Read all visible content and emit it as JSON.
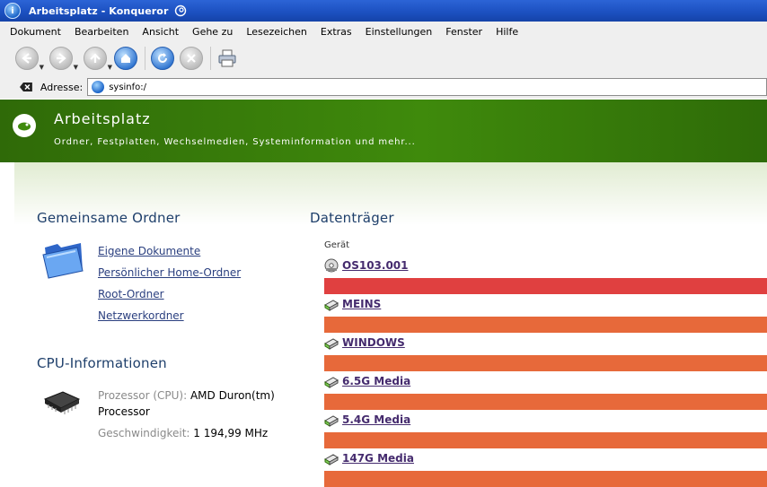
{
  "window": {
    "title": "Arbeitsplatz - Konqueror"
  },
  "menu": [
    "Dokument",
    "Bearbeiten",
    "Ansicht",
    "Gehe zu",
    "Lesezeichen",
    "Extras",
    "Einstellungen",
    "Fenster",
    "Hilfe"
  ],
  "toolbar": {
    "back_icon": "arrow-left-icon",
    "forward_icon": "arrow-right-icon",
    "up_icon": "arrow-up-icon",
    "home_icon": "home-icon",
    "reload_icon": "reload-icon",
    "stop_icon": "stop-icon",
    "print_icon": "printer-icon"
  },
  "location": {
    "label": "Adresse:",
    "url": "sysinfo:/"
  },
  "banner": {
    "title": "Arbeitsplatz",
    "subtitle": "Ordner, Festplatten, Wechselmedien, Systeminformation und mehr..."
  },
  "shared_folders": {
    "heading": "Gemeinsame Ordner",
    "links": [
      "Eigene Dokumente",
      "Persönlicher Home-Ordner",
      "Root-Ordner",
      "Netzwerkordner"
    ]
  },
  "cpu": {
    "heading": "CPU-Informationen",
    "processor_label": "Prozessor (CPU):",
    "processor_value": "AMD Duron(tm)",
    "processor_value2": "Processor",
    "speed_label": "Geschwindigkeit:",
    "speed_value": "1 194,99 MHz"
  },
  "drives": {
    "heading": "Datenträger",
    "column_header": "Gerät",
    "items": [
      {
        "name": "OS103.001",
        "icon": "cdrom-icon",
        "bar_color": "#e04040"
      },
      {
        "name": "MEINS",
        "icon": "harddisk-icon",
        "bar_color": "#e7693a"
      },
      {
        "name": "WINDOWS",
        "icon": "harddisk-icon",
        "bar_color": "#e7693a"
      },
      {
        "name": "6.5G Media",
        "icon": "harddisk-icon",
        "bar_color": "#e7693a"
      },
      {
        "name": "5.4G Media",
        "icon": "harddisk-icon",
        "bar_color": "#e7693a"
      },
      {
        "name": "147G Media",
        "icon": "harddisk-icon",
        "bar_color": "#e7693a"
      }
    ]
  },
  "colors": {
    "banner_green": "#3f8a0c",
    "link_blue": "#2a3f7f",
    "heading_blue": "#1e3f6b"
  }
}
